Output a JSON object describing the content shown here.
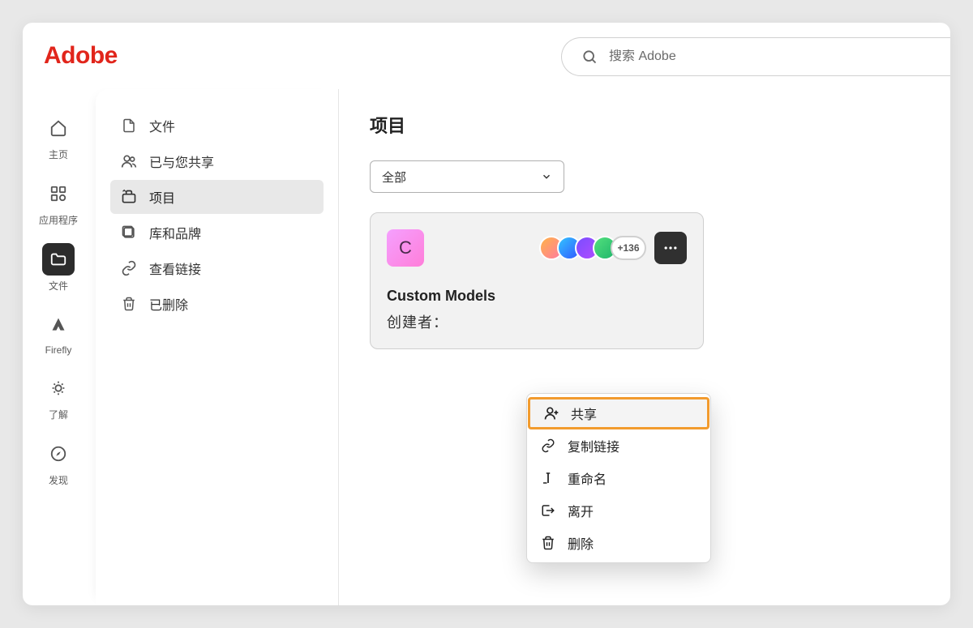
{
  "brand": "Adobe",
  "search": {
    "placeholder": "搜索 Adobe"
  },
  "nav": {
    "home": "主页",
    "apps": "应用程序",
    "files": "文件",
    "firefly": "Firefly",
    "learn": "了解",
    "discover": "发现"
  },
  "side": {
    "files": "文件",
    "shared": "已与您共享",
    "projects": "项目",
    "libraries": "库和品牌",
    "links": "查看链接",
    "deleted": "已删除"
  },
  "main": {
    "title": "项目",
    "filter": "全部"
  },
  "card": {
    "thumb_letter": "C",
    "name": "Custom Models",
    "creator_label": "创建者：",
    "creator_value": "",
    "overflow_count": "+136"
  },
  "menu": {
    "share": "共享",
    "copy_link": "复制链接",
    "rename": "重命名",
    "leave": "离开",
    "delete": "删除"
  }
}
